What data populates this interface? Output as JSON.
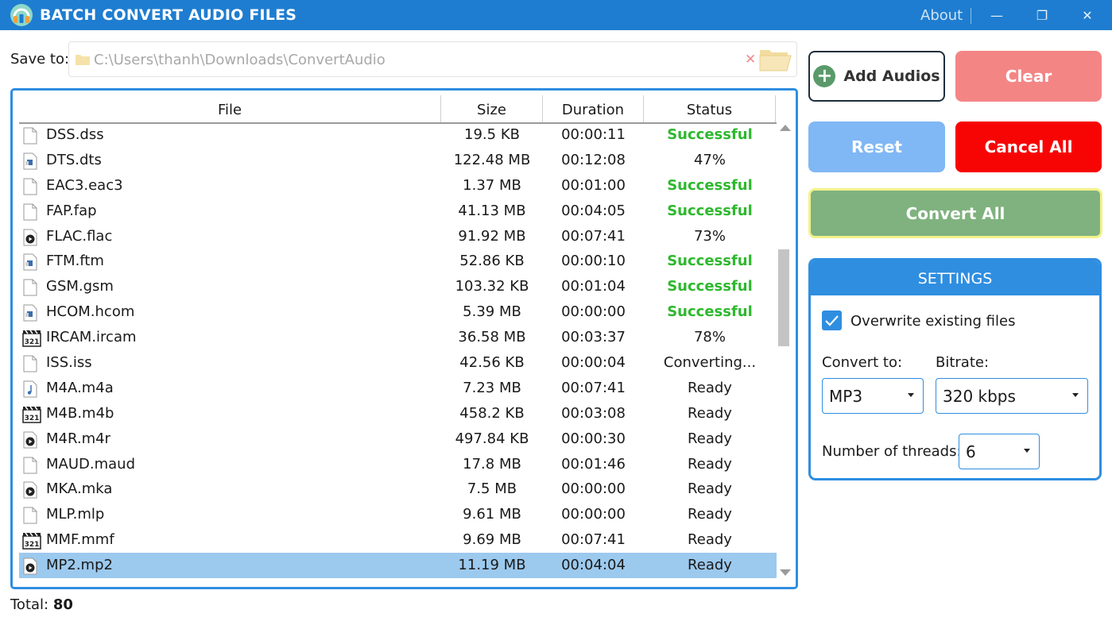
{
  "window": {
    "title": "BATCH CONVERT AUDIO FILES",
    "about": "About",
    "minimize_glyph": "—",
    "restore_glyph": "❐",
    "close_glyph": "✕"
  },
  "save_to": {
    "label": "Save to:",
    "path": "C:\\Users\\thanh\\Downloads\\ConvertAudio",
    "clear_glyph": "✕"
  },
  "table": {
    "headers": {
      "file": "File",
      "size": "Size",
      "duration": "Duration",
      "status": "Status"
    },
    "rows": [
      {
        "file": "DSS.dss",
        "size": "19.5 KB",
        "duration": "00:00:11",
        "status": "Successful",
        "icon": "blank-file-icon"
      },
      {
        "file": "DTS.dts",
        "size": "122.48 MB",
        "duration": "00:12:08",
        "status": "47%",
        "icon": "media-file-icon"
      },
      {
        "file": "EAC3.eac3",
        "size": "1.37 MB",
        "duration": "00:01:00",
        "status": "Successful",
        "icon": "blank-file-icon"
      },
      {
        "file": "FAP.fap",
        "size": "41.13 MB",
        "duration": "00:04:05",
        "status": "Successful",
        "icon": "blank-file-icon"
      },
      {
        "file": "FLAC.flac",
        "size": "91.92 MB",
        "duration": "00:07:41",
        "status": "73%",
        "icon": "play-file-icon"
      },
      {
        "file": "FTM.ftm",
        "size": "52.86 KB",
        "duration": "00:00:10",
        "status": "Successful",
        "icon": "media-file-icon"
      },
      {
        "file": "GSM.gsm",
        "size": "103.32 KB",
        "duration": "00:01:04",
        "status": "Successful",
        "icon": "blank-file-icon"
      },
      {
        "file": "HCOM.hcom",
        "size": "5.39 MB",
        "duration": "00:00:00",
        "status": "Successful",
        "icon": "media-file-icon"
      },
      {
        "file": "IRCAM.ircam",
        "size": "36.58 MB",
        "duration": "00:03:37",
        "status": "78%",
        "icon": "clapper-321-icon"
      },
      {
        "file": "ISS.iss",
        "size": "42.56 KB",
        "duration": "00:00:04",
        "status": "Converting...",
        "icon": "blank-file-icon"
      },
      {
        "file": "M4A.m4a",
        "size": "7.23 MB",
        "duration": "00:07:41",
        "status": "Ready",
        "icon": "music-note-file-icon"
      },
      {
        "file": "M4B.m4b",
        "size": "458.2 KB",
        "duration": "00:03:08",
        "status": "Ready",
        "icon": "clapper-321-icon"
      },
      {
        "file": "M4R.m4r",
        "size": "497.84 KB",
        "duration": "00:00:30",
        "status": "Ready",
        "icon": "play-file-icon"
      },
      {
        "file": "MAUD.maud",
        "size": "17.8 MB",
        "duration": "00:01:46",
        "status": "Ready",
        "icon": "blank-file-icon"
      },
      {
        "file": "MKA.mka",
        "size": "7.5 MB",
        "duration": "00:00:00",
        "status": "Ready",
        "icon": "play-file-icon"
      },
      {
        "file": "MLP.mlp",
        "size": "9.61 MB",
        "duration": "00:00:00",
        "status": "Ready",
        "icon": "blank-file-icon"
      },
      {
        "file": "MMF.mmf",
        "size": "9.69 MB",
        "duration": "00:07:41",
        "status": "Ready",
        "icon": "clapper-321-icon"
      },
      {
        "file": "MP2.mp2",
        "size": "11.19 MB",
        "duration": "00:04:04",
        "status": "Ready",
        "icon": "play-file-icon",
        "selected": true
      }
    ]
  },
  "total": {
    "label": "Total:",
    "value": "80"
  },
  "buttons": {
    "add_audios": "Add Audios",
    "add_glyph": "+",
    "clear": "Clear",
    "reset": "Reset",
    "cancel_all": "Cancel All",
    "convert_all": "Convert All"
  },
  "settings": {
    "title": "SETTINGS",
    "overwrite_label": "Overwrite existing files",
    "overwrite_checked": true,
    "convert_to_label": "Convert to:",
    "convert_to_value": "MP3",
    "bitrate_label": "Bitrate:",
    "bitrate_value": "320 kbps",
    "threads_label": "Number of threads:",
    "threads_value": "6"
  },
  "colors": {
    "titlebar": "#1e7dd0",
    "accent": "#2f8ee0",
    "success": "#2eb82e",
    "clear": "#f48585",
    "reset": "#80b7f5",
    "cancel": "#f70505",
    "convert": "#7fb27f",
    "selected_row": "#9cc9ee"
  }
}
